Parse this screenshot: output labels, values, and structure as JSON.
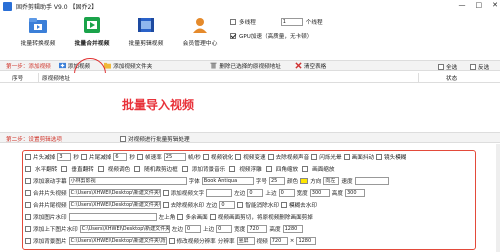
{
  "window": {
    "title": "固乔剪辑助手 V9.0 【固乔2】",
    "buttons": [
      "—",
      "□",
      "✕"
    ]
  },
  "toolbar": {
    "items": [
      {
        "label": "批量转换视频",
        "icon": "folder-icon",
        "active": false
      },
      {
        "label": "批量合并视频",
        "icon": "merge-icon",
        "active": true
      },
      {
        "label": "批量剪辑视频",
        "icon": "film-icon",
        "active": false
      },
      {
        "label": "会员管理中心",
        "icon": "user-icon",
        "active": false
      }
    ],
    "multithread_label": "多线程",
    "thread_count": "1",
    "thread_unit": "个线程",
    "gpu_label": "GPU加速（高质量，无卡顿）",
    "gpu_checked": true
  },
  "step1": {
    "label": "第一步：添加视频",
    "add_video": "添加视频",
    "add_folder": "添加视频文件夹",
    "delete_selected": "删除已选择的原视频地址",
    "clear_list": "清空表格",
    "select_all": "全选",
    "invert": "反选"
  },
  "list": {
    "col_index": "序号",
    "col_path": "原视频地址",
    "col_status": "状态"
  },
  "overlay_annotation": "批量导入视频",
  "step2": {
    "label": "第二步：设置剪辑选项",
    "hint": "对视频进行批量剪辑处理"
  },
  "options": {
    "row1": {
      "cut_head_label": "片头减掉",
      "cut_head_val": "3",
      "cut_head_unit": "秒",
      "cut_tail_label": "片尾减掉",
      "cut_tail_val": "6",
      "cut_tail_unit": "秒",
      "fps_label": "帧速率",
      "fps_val": "25",
      "fps_unit": "帧/秒",
      "opt1": "视频锐化",
      "opt2": "视频变速",
      "opt3": "去除视频声音",
      "opt4": "闪烁光晕",
      "opt5": "画面抖动",
      "opt6": "镜头模糊"
    },
    "row2": {
      "mirror": "水平翻转",
      "vflip": "垂直翻转",
      "color": "视频调色",
      "crop": "随机裁剪边框",
      "bgmusic": "添加背景音乐",
      "emboss": "视频浮雕",
      "corner": "四角缩放",
      "zoom": "画面缩放"
    },
    "row3": {
      "scroll_label": "添加滚动字幕",
      "scroll_text": "小林剪影视",
      "font_label": "字体",
      "font_val": "Book Antiqua",
      "size_label": "字号",
      "size_val": "25",
      "color_label": "颜色",
      "dir_label": "方向",
      "dir_val": "向左",
      "speed_label": "速度"
    },
    "row4": {
      "merge_head": "合并片头视频",
      "head_path": "C:\\Users\\XHWEI\\Desktop\\新建文件夹\\片头.mp4",
      "add_text": "添加视频文字",
      "left_label": "左边",
      "left_val": "0",
      "top_label": "上边",
      "top_val": "0",
      "width_label": "宽度",
      "width_val": "300",
      "height_label": "高度",
      "height_val": "300"
    },
    "row5": {
      "merge_tail": "合并片尾视频",
      "tail_path": "C:\\Users\\XHWEI\\Desktop\\新建文件夹\\片尾.mp4",
      "remove_watermark": "去除视频水印",
      "left_label": "左边",
      "left_val": "0",
      "smart": "智能消除水印",
      "blur": "模糊去水印"
    },
    "row6": {
      "add_watermark": "添加图片水印",
      "position": "左上角",
      "repeat": "多余画面",
      "crop_border": "视频画面剪切，将原视频删除画面剪掉"
    },
    "row7": {
      "pic_label": "添加上下图片水印",
      "pic_path": "C:\\Users\\XHWEI\\Desktop\\新建文件夹\\水印.png",
      "left_label": "左边",
      "left_val": "0",
      "top_label": "上边",
      "top_val": "0",
      "w_label": "宽度",
      "w_val": "720",
      "h_label": "高度",
      "h_val": "1280"
    },
    "row8": {
      "bg_label": "添加背景图片",
      "bg_path": "C:\\Users\\XHWEI\\Desktop\\新建文件夹\\背景.jpg",
      "change_label": "修改视频分辨率",
      "res_label": "分辨率",
      "res_val": "竖屏",
      "video_label": "视频",
      "video_val": "720",
      "x": "×",
      "h_val": "1280"
    }
  },
  "colors": {
    "accent_red": "#e03030",
    "annotation_red": "#e8323a",
    "active_green": "#1aa34a"
  }
}
